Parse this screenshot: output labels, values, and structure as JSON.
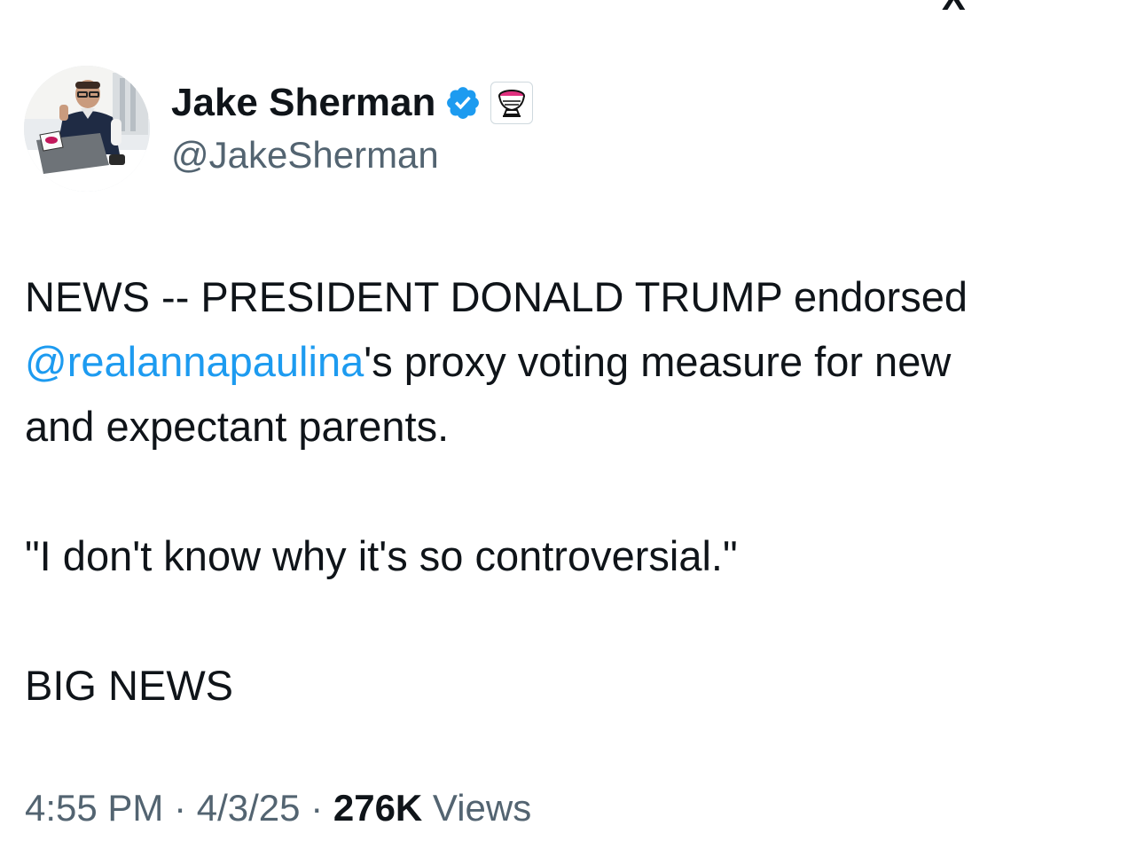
{
  "header": {
    "partial_glyph": "X"
  },
  "author": {
    "display_name": "Jake Sherman",
    "handle": "@JakeSherman",
    "avatar_icon": "profile-photo",
    "verified_icon": "verified-badge-icon",
    "affiliate_icon": "punchbowl-affiliate-icon"
  },
  "tweet": {
    "line1_prefix": "NEWS -- PRESIDENT DONALD TRUMP endorsed",
    "mention": "@realannapaulina",
    "line2_suffix": "'s proxy voting measure for new",
    "line3": "and expectant parents.",
    "quote": "\"I don't know why it's so controversial.\"",
    "closing": "BIG NEWS"
  },
  "meta": {
    "time": "4:55 PM",
    "sep1": " · ",
    "date": "4/3/25",
    "sep2": " · ",
    "views_count": "276K",
    "views_label": " Views"
  },
  "colors": {
    "text": "#0f1419",
    "secondary": "#536471",
    "link": "#1d9bf0",
    "verified": "#1d9bf0"
  }
}
